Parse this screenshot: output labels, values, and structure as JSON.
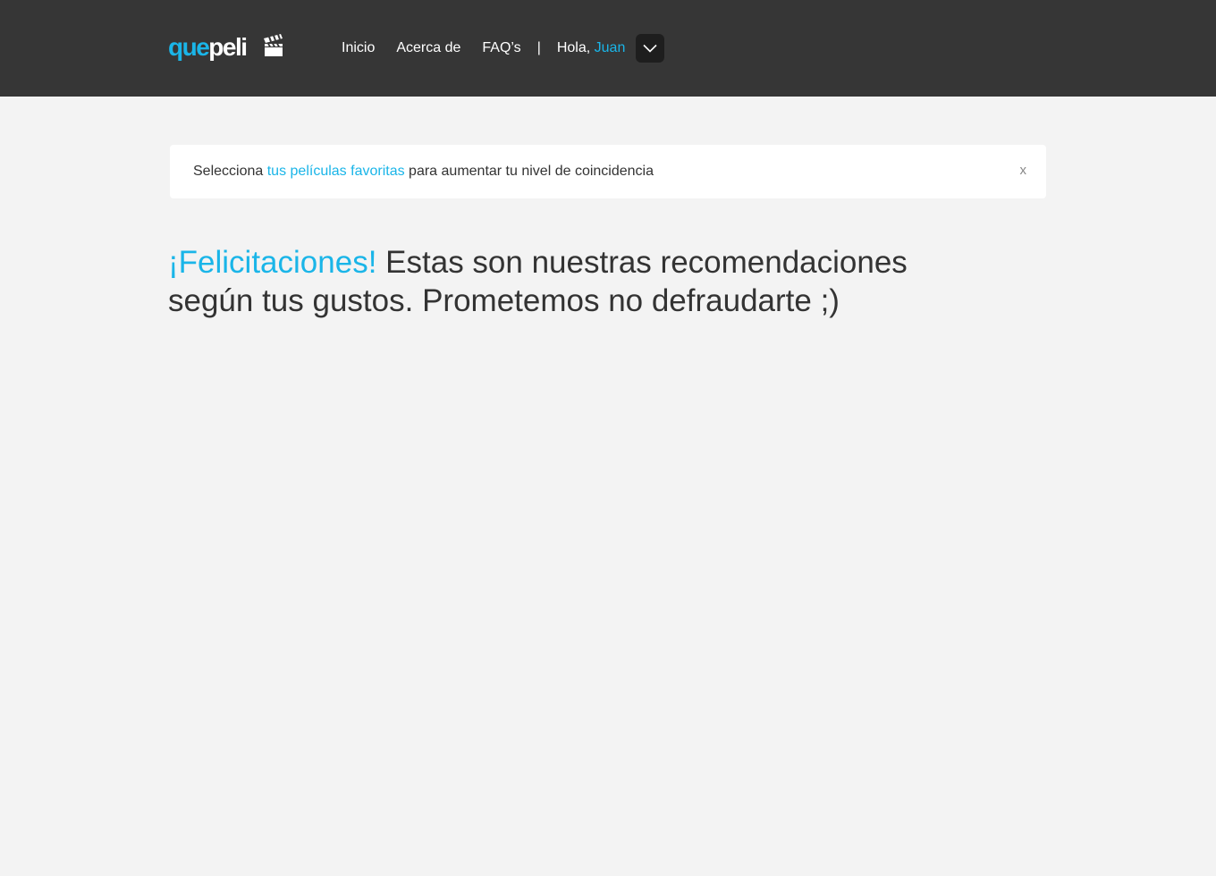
{
  "header": {
    "logo": {
      "part1": "que",
      "part2": "peli",
      "icon": "clapperboard-icon"
    },
    "nav": {
      "items": [
        {
          "label": "Inicio"
        },
        {
          "label": "Acerca de"
        },
        {
          "label": "FAQ’s"
        }
      ],
      "separator": "|",
      "greeting": "Hola,",
      "user_name": "Juan",
      "dropdown_icon": "chevron-down-icon"
    }
  },
  "alert": {
    "text_before": "Selecciona",
    "link_text": "tus películas favoritas",
    "text_after": "para aumentar tu nivel de coincidencia",
    "close_label": "x"
  },
  "main": {
    "headline_accent": "¡Felicitaciones!",
    "headline_rest": "Estas son nuestras recomendaciones según tus gustos. Prometemos no defraudarte ;)"
  },
  "colors": {
    "accent": "#1ab5e8",
    "header_bg": "#363636",
    "page_bg": "#f3f3f3",
    "text": "#333333"
  }
}
